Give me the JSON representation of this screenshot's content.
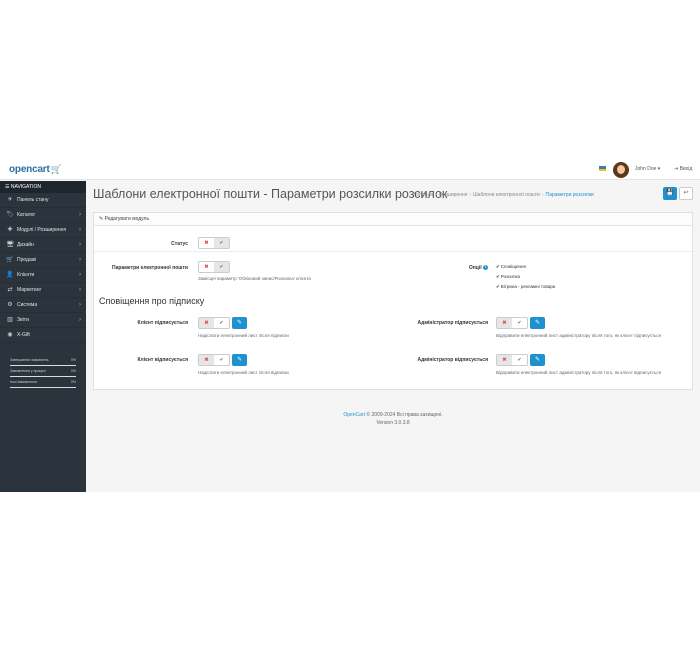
{
  "header": {
    "logo": "opencart",
    "logo_cart": "🛒",
    "user_name": "John Doe ▾",
    "logout_label": "⇥ Вихід"
  },
  "sidebar": {
    "nav_title": "☰ NAVIGATION",
    "items": [
      {
        "label": "Панель стану",
        "icon": "✈",
        "has_chevron": false
      },
      {
        "label": "Каталог",
        "icon": "🏷",
        "has_chevron": true
      },
      {
        "label": "Модулі / Розширення",
        "icon": "✚",
        "has_chevron": true
      },
      {
        "label": "Дизайн",
        "icon": "🖥",
        "has_chevron": true
      },
      {
        "label": "Продажі",
        "icon": "🛒",
        "has_chevron": true
      },
      {
        "label": "Клієнти",
        "icon": "👤",
        "has_chevron": true
      },
      {
        "label": "Маркетинг",
        "icon": "⇄",
        "has_chevron": true
      },
      {
        "label": "Система",
        "icon": "⚙",
        "has_chevron": true
      },
      {
        "label": "Звіти",
        "icon": "▥",
        "has_chevron": true
      },
      {
        "label": "X-Gift",
        "icon": "◉",
        "has_chevron": false
      }
    ],
    "stats": [
      {
        "label": "Завершених замовлень",
        "percent": "0%",
        "fill": 0
      },
      {
        "label": "Замовлення у процесі",
        "percent": "0%",
        "fill": 0
      },
      {
        "label": "Інші замовлення",
        "percent": "0%",
        "fill": 0
      }
    ]
  },
  "page": {
    "title": "Шаблони електронної пошти - Параметри розсилки розсилок",
    "breadcrumb": [
      "Головна",
      "Розширення",
      "Шаблони електронної пошти",
      "Параметри розсилки"
    ],
    "save_icon": "💾",
    "back_icon": "↩"
  },
  "panel": {
    "heading": "✎ Редагувати модуль",
    "status_label": "Статус",
    "mail_params_label": "Параметри електронної пошти",
    "mail_params_help": "Замісцеі параметр 'Обліковий запис/Розсилка' клієнта",
    "options_label": "Опції",
    "options": [
      "Сповіщення",
      "Розсилка",
      "Вітрина - рекламні товари"
    ],
    "section_title": "Сповіщення про підписку",
    "rows": [
      {
        "left_label": "Клієнт підписується",
        "left_help": "Надіслати електронний лист після підписки",
        "right_label": "Адміністратор підписується",
        "right_help": "Відправити електронний лист адміністратору після того, як клієнт підписується"
      },
      {
        "left_label": "Клієнт відписується",
        "left_help": "Надіслати електронний лист після відписки",
        "right_label": "Адміністратор відписується",
        "right_help": "Відправити електронний лист адміністратору після того, як клієнт відписується"
      }
    ],
    "toggle_off": "✖",
    "toggle_on": "✔",
    "edit_icon": "✎"
  },
  "footer": {
    "brand": "OpenCart",
    "copyright": "© 2009-2024 Всі права захищені.",
    "version": "Version 3.0.3.8"
  }
}
